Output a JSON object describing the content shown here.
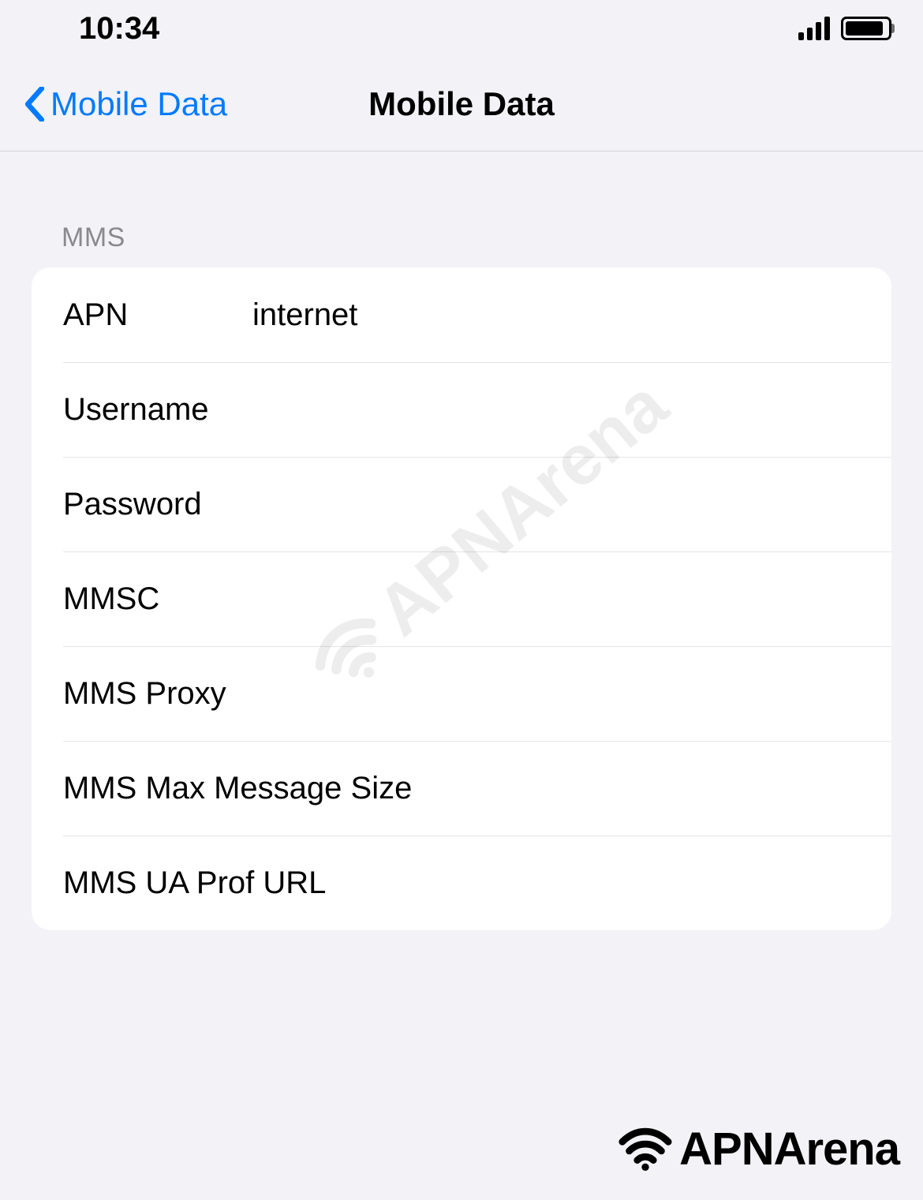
{
  "status": {
    "time": "10:34"
  },
  "nav": {
    "back_label": "Mobile Data",
    "title": "Mobile Data"
  },
  "section": {
    "header": "MMS"
  },
  "rows": {
    "apn": {
      "label": "APN",
      "value": "internet"
    },
    "username": {
      "label": "Username",
      "value": ""
    },
    "password": {
      "label": "Password",
      "value": ""
    },
    "mmsc": {
      "label": "MMSC",
      "value": ""
    },
    "mms_proxy": {
      "label": "MMS Proxy",
      "value": ""
    },
    "mms_max": {
      "label": "MMS Max Message Size",
      "value": ""
    },
    "mms_ua": {
      "label": "MMS UA Prof URL",
      "value": ""
    }
  },
  "watermark": {
    "text": "APNArena"
  },
  "logo": {
    "text": "APNArena"
  }
}
